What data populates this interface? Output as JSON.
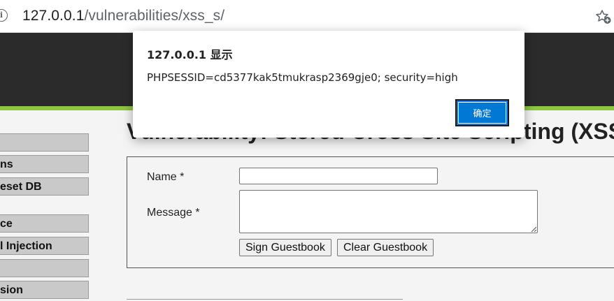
{
  "browser": {
    "url_host": "127.0.0.1",
    "url_path": "/vulnerabilities/xss_s/",
    "info_icon": "info-icon",
    "favorite_icon": "star-add-icon"
  },
  "sidebar": {
    "items": [
      {
        "label": ""
      },
      {
        "label": "ns"
      },
      {
        "label": "eset DB"
      },
      {
        "label": "ce"
      },
      {
        "label": "l Injection"
      },
      {
        "label": ""
      },
      {
        "label": "sion"
      }
    ]
  },
  "main": {
    "title": "Vulnerability: Stored Cross Site Scripting (XSS)",
    "form": {
      "name_label": "Name *",
      "message_label": "Message *",
      "name_value": "",
      "message_value": "",
      "sign_button": "Sign Guestbook",
      "clear_button": "Clear Guestbook"
    }
  },
  "dialog": {
    "title": "127.0.0.1 显示",
    "message": "PHPSESSID=cd5377kak5tmukrasp2369gje0; security=high",
    "ok_label": "确定"
  },
  "colors": {
    "header_bg": "#2b2b2b",
    "accent_green": "#8dc63f",
    "dialog_button": "#0078d4"
  }
}
